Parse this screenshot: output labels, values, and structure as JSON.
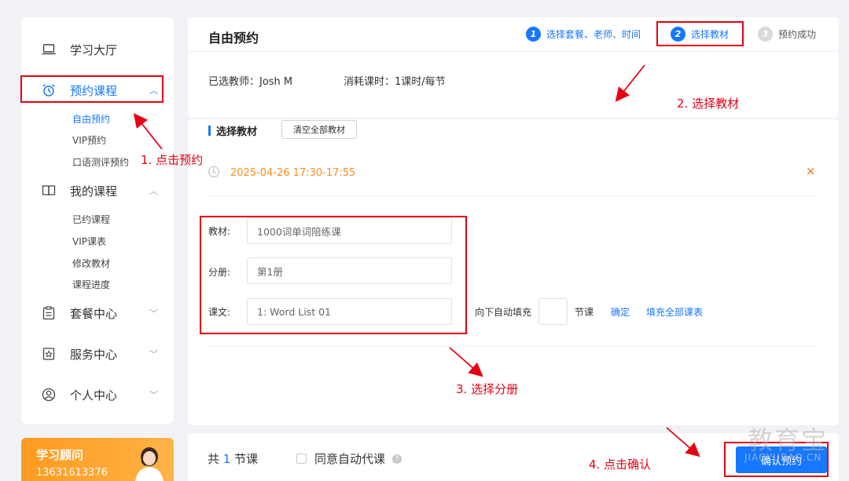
{
  "sidebar": {
    "items": [
      {
        "label": "学习大厅",
        "icon": "laptop-icon"
      },
      {
        "label": "预约课程",
        "icon": "alarm-clock-icon",
        "active": true,
        "sub": [
          "自由预约",
          "VIP预约",
          "口语测评预约"
        ]
      },
      {
        "label": "我的课程",
        "icon": "book-icon",
        "sub": [
          "已约课程",
          "VIP课表",
          "修改教材",
          "课程进度"
        ]
      },
      {
        "label": "套餐中心",
        "icon": "clipboard-icon"
      },
      {
        "label": "服务中心",
        "icon": "star-badge-icon"
      },
      {
        "label": "个人中心",
        "icon": "user-circle-icon"
      }
    ]
  },
  "advisor": {
    "title": "学习顾问",
    "phone": "13631613376"
  },
  "header": {
    "title": "自由预约",
    "steps": [
      {
        "num": "1",
        "label": "选择套餐、老师、时间",
        "state": "done"
      },
      {
        "num": "2",
        "label": "选择教材",
        "state": "current"
      },
      {
        "num": "3",
        "label": "预约成功",
        "state": "todo"
      }
    ],
    "teacher": "已选教师：Josh M",
    "cost": "消耗课时：1课时/每节"
  },
  "materials": {
    "section_title": "选择教材",
    "clear_all": "清空全部教材",
    "slot_time": "2025-04-26 17:30-17:55",
    "close": "×",
    "fields": [
      {
        "label": "教材:",
        "value": "1000词单词陪练课"
      },
      {
        "label": "分册:",
        "value": "第1册"
      },
      {
        "label": "课文:",
        "value": "1: Word List 01"
      }
    ],
    "auto_fill_label": "向下自动填充",
    "auto_fill_unit": "节课",
    "auto_fill_confirm": "确定",
    "fill_all": "填充全部课表"
  },
  "footer": {
    "total_prefix": "共",
    "total_count": "1",
    "total_suffix": "节课",
    "agree_label": "同意自动代课",
    "help": "?",
    "confirm": "确认预约"
  },
  "annotations": {
    "a1": "1. 点击预约",
    "a2": "2. 选择教材",
    "a3": "3. 选择分册",
    "a4": "4. 点击确认"
  },
  "watermark": {
    "line1": "教育宝",
    "line2": "JIAOYUBAO.CN"
  },
  "colors": {
    "accent": "#1677ff",
    "annotation": "#e60012",
    "time": "#ff8c1a",
    "advisor": "#ff9a1f"
  }
}
